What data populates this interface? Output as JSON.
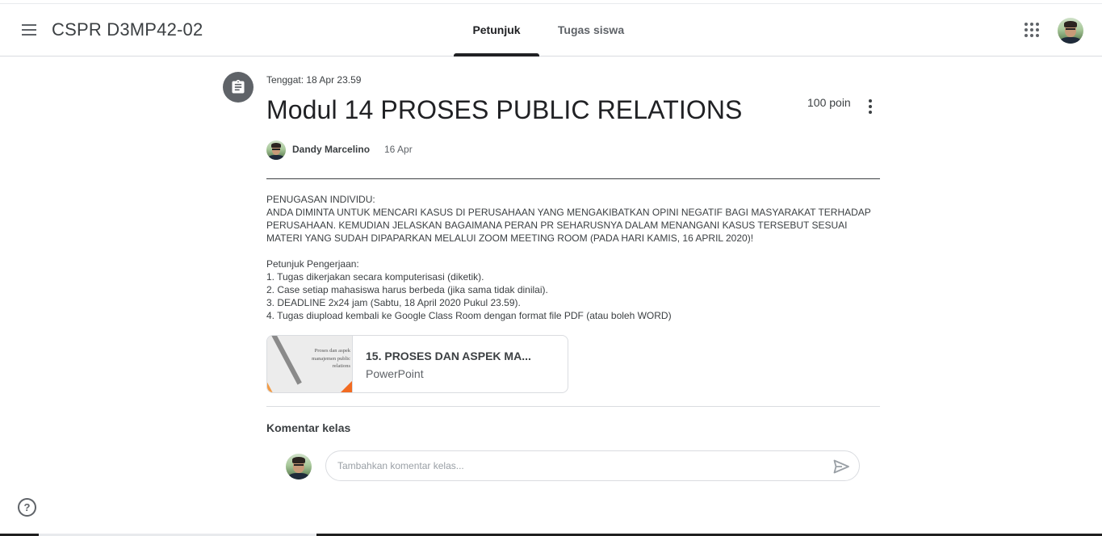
{
  "header": {
    "course_title": "CSPR D3MP42-02",
    "tabs": [
      {
        "label": "Petunjuk",
        "active": true
      },
      {
        "label": "Tugas siswa",
        "active": false
      }
    ],
    "icons": [
      "menu-icon",
      "apps-grid-icon",
      "user-avatar"
    ]
  },
  "assignment": {
    "icon": "assignment-icon",
    "due": "Tenggat: 18 Apr 23.59",
    "title": "Modul 14 PROSES PUBLIC RELATIONS",
    "points": "100 poin",
    "author": "Dandy Marcelino",
    "posted_date": "16 Apr",
    "description": "PENUGASAN INDIVIDU:\nANDA DIMINTA UNTUK MENCARI KASUS DI PERUSAHAAN YANG MENGAKIBATKAN OPINI NEGATIF BAGI MASYARAKAT TERHADAP PERUSAHAAN. KEMUDIAN JELASKAN BAGAIMANA PERAN PR SEHARUSNYA DALAM MENANGANI KASUS TERSEBUT SESUAI MATERI YANG SUDAH DIPAPARKAN MELALUI ZOOM MEETING ROOM (PADA HARI KAMIS, 16 APRIL 2020)!\n\nPetunjuk Pengerjaan:\n1. Tugas dikerjakan secara komputerisasi (diketik).\n2. Case setiap mahasiswa harus berbeda (jika sama tidak dinilai).\n3. DEADLINE 2x24 jam (Sabtu, 18 April 2020 Pukul 23.59).\n4. Tugas diupload kembali ke Google Class Room dengan format file PDF (atau boleh WORD)"
  },
  "attachment": {
    "title": "15. PROSES DAN ASPEK MA...",
    "type": "PowerPoint",
    "thumbnail_lines": [
      "Proses dan aspek",
      "manajemen public",
      "relations"
    ],
    "colors": {
      "accent_orange": "#f26b21",
      "stripe_orange": "#f29b45",
      "stripe_gray": "#a9a9a9"
    }
  },
  "comments": {
    "title": "Komentar kelas",
    "placeholder": "Tambahkan komentar kelas...",
    "value": ""
  },
  "colors": {
    "text_primary": "#202124",
    "text_secondary": "#5f6368",
    "border": "#dadce0",
    "icon_bg": "#5f6368"
  }
}
